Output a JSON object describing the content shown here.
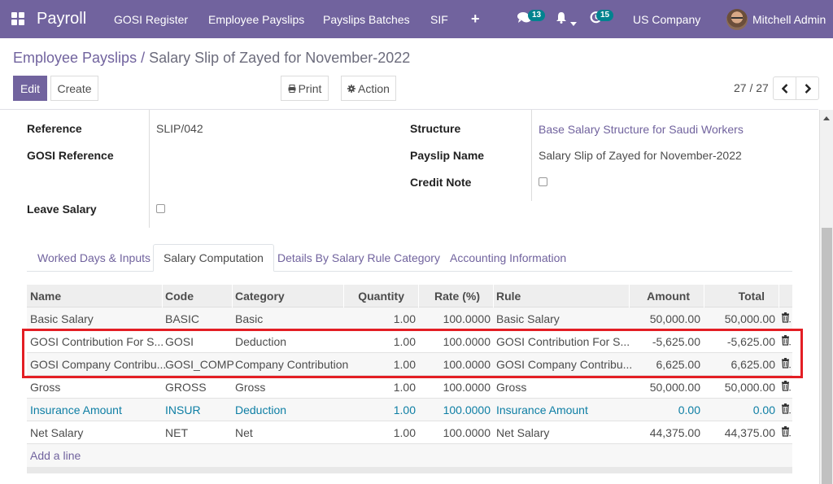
{
  "navbar": {
    "brand": "Payroll",
    "menu": [
      "GOSI Register",
      "Employee Payslips",
      "Payslips Batches",
      "SIF"
    ],
    "plus_label": "+",
    "messages_badge": "13",
    "activity_badge": "15",
    "company": "US Company",
    "user": "Mitchell Admin",
    "bg_color": "#71639e"
  },
  "breadcrumb": {
    "parent": "Employee Payslips",
    "separator": "/",
    "current": "Salary Slip of Zayed for November-2022"
  },
  "toolbar": {
    "edit_label": "Edit",
    "create_label": "Create",
    "print_label": "Print",
    "action_label": "Action",
    "print_icon": "print-icon",
    "action_icon": "gear-icon"
  },
  "pager": {
    "value": "27 / 27",
    "prev_icon": "chevron-left-icon",
    "next_icon": "chevron-right-icon"
  },
  "form": {
    "reference_label": "Reference",
    "reference_value": "SLIP/042",
    "gosi_reference_label": "GOSI Reference",
    "gosi_reference_value": "",
    "leave_salary_label": "Leave Salary",
    "leave_salary_checked": false,
    "structure_label": "Structure",
    "structure_value": "Base Salary Structure for Saudi Workers",
    "payslip_name_label": "Payslip Name",
    "payslip_name_value": "Salary Slip of Zayed for November-2022",
    "credit_note_label": "Credit Note",
    "credit_note_checked": false
  },
  "tabs": [
    {
      "label": "Worked Days & Inputs",
      "active": false
    },
    {
      "label": "Salary Computation",
      "active": true
    },
    {
      "label": "Details By Salary Rule Category",
      "active": false
    },
    {
      "label": "Accounting Information",
      "active": false
    }
  ],
  "table": {
    "columns": [
      "Name",
      "Code",
      "Category",
      "Quantity",
      "Rate (%)",
      "Rule",
      "Amount",
      "Total"
    ],
    "rows": [
      {
        "name": "Basic Salary",
        "code": "BASIC",
        "category": "Basic",
        "quantity": "1.00",
        "rate": "100.0000",
        "rule": "Basic Salary",
        "amount": "50,000.00",
        "total": "50,000.00"
      },
      {
        "name": "GOSI Contribution For S...",
        "code": "GOSI",
        "category": "Deduction",
        "quantity": "1.00",
        "rate": "100.0000",
        "rule": "GOSI Contribution For S...",
        "amount": "-5,625.00",
        "total": "-5,625.00"
      },
      {
        "name": "GOSI Company Contribu...",
        "code": "GOSI_COMP",
        "category": "Company Contribution",
        "quantity": "1.00",
        "rate": "100.0000",
        "rule": "GOSI Company Contribu...",
        "amount": "6,625.00",
        "total": "6,625.00"
      },
      {
        "name": "Gross",
        "code": "GROSS",
        "category": "Gross",
        "quantity": "1.00",
        "rate": "100.0000",
        "rule": "Gross",
        "amount": "50,000.00",
        "total": "50,000.00"
      },
      {
        "name": "Insurance Amount",
        "code": "INSUR",
        "category": "Deduction",
        "quantity": "1.00",
        "rate": "100.0000",
        "rule": "Insurance Amount",
        "amount": "0.00",
        "total": "0.00"
      },
      {
        "name": "Net Salary",
        "code": "NET",
        "category": "Net",
        "quantity": "1.00",
        "rate": "100.0000",
        "rule": "Net Salary",
        "amount": "44,375.00",
        "total": "44,375.00"
      }
    ],
    "add_line_label": "Add a line",
    "row_delete_icon": "trash-icon"
  },
  "annotation": {
    "highlight_color": "#e31e24",
    "highlighted_rows": [
      "GOSI",
      "GOSI_COMP"
    ]
  }
}
